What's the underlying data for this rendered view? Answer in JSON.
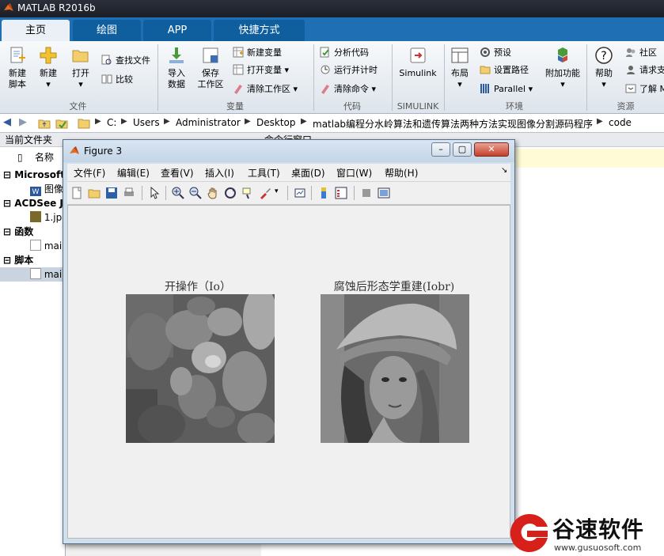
{
  "window": {
    "title": "MATLAB R2016b"
  },
  "tabs": [
    {
      "label": "主页",
      "active": true
    },
    {
      "label": "绘图",
      "active": false
    },
    {
      "label": "APP",
      "active": false
    },
    {
      "label": "快捷方式",
      "active": false
    }
  ],
  "ribbon": {
    "file": {
      "new_script": "新建\n脚本",
      "new": "新建",
      "open": "打开",
      "find_files": "查找文件",
      "compare": "比较",
      "group": "文件"
    },
    "variable": {
      "import": "导入\n数据",
      "save_ws": "保存\n工作区",
      "new_var": "新建变量",
      "open_var": "打开变量",
      "clear_ws": "清除工作区",
      "group": "变量"
    },
    "code": {
      "analyze": "分析代码",
      "run_time": "运行并计时",
      "clear_cmd": "清除命令",
      "group": "代码"
    },
    "simulink": {
      "label": "Simulink",
      "group": "SIMULINK"
    },
    "env": {
      "layout": "布局",
      "prefs": "预设",
      "set_path": "设置路径",
      "parallel": "Parallel",
      "addons": "附加功能",
      "group": "环境"
    },
    "resources": {
      "help": "帮助",
      "community": "社区",
      "request": "请求支",
      "learn": "了解 M",
      "group": "资源"
    }
  },
  "path": {
    "segments": [
      "C:",
      "Users",
      "Administrator",
      "Desktop",
      "matlab编程分水岭算法和遗传算法两种方法实现图像分割源码程序",
      "code"
    ]
  },
  "left_panel": {
    "header": "当前文件夹",
    "col_name": "名称",
    "rows": [
      {
        "label": "Microsoft",
        "bold": true
      },
      {
        "label": "图像"
      },
      {
        "label": "ACDSee J",
        "bold": true
      },
      {
        "label": "1.jp"
      },
      {
        "label": "函数",
        "bold": true
      },
      {
        "label": "mai"
      },
      {
        "label": "脚本",
        "bold": true
      },
      {
        "label": "mai"
      }
    ]
  },
  "right_panel": {
    "header": "命令行窗口"
  },
  "figure": {
    "title": "Figure 3",
    "menu": [
      "文件(F)",
      "编辑(E)",
      "查看(V)",
      "插入(I)",
      "工具(T)",
      "桌面(D)",
      "窗口(W)",
      "帮助(H)"
    ],
    "plots": [
      {
        "title": "开操作（Io）"
      },
      {
        "title": "腐蚀后形态学重建(Iobr)"
      }
    ]
  },
  "watermark": {
    "brand": "谷速软件",
    "url": "www.gusuosoft.com",
    "colors": {
      "brand": "#d8201b"
    }
  }
}
